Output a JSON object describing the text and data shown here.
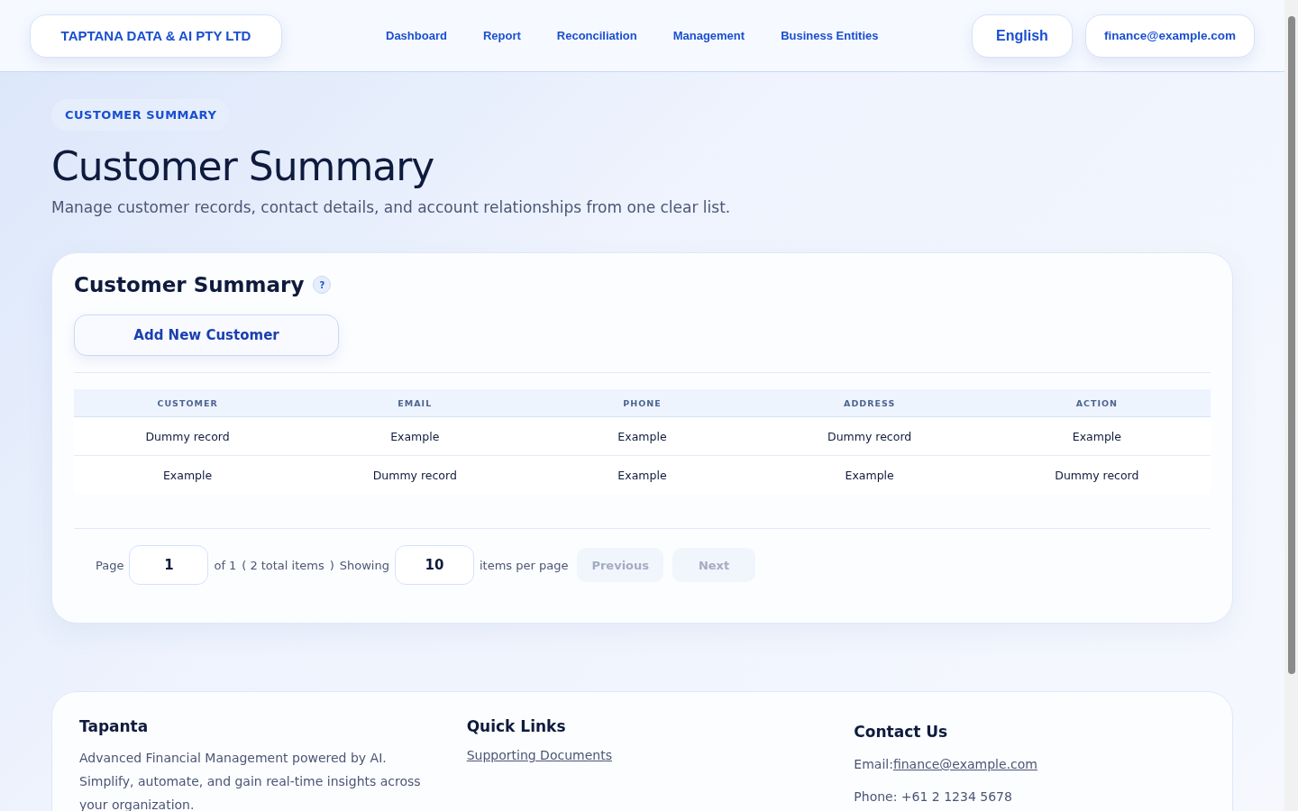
{
  "header": {
    "brand": "TAPTANA DATA & AI PTY LTD",
    "nav": [
      {
        "label": "Dashboard"
      },
      {
        "label": "Report"
      },
      {
        "label": "Reconciliation"
      },
      {
        "label": "Management"
      },
      {
        "label": "Business Entities"
      }
    ],
    "language": "English",
    "account": "finance@example.com"
  },
  "hero": {
    "eyebrow": "CUSTOMER SUMMARY",
    "title": "Customer Summary",
    "subtitle": "Manage customer records, contact details, and account relationships from one clear list."
  },
  "card": {
    "title": "Customer Summary",
    "help": "?",
    "add_button": "Add New Customer",
    "table": {
      "columns": [
        "CUSTOMER",
        "EMAIL",
        "PHONE",
        "ADDRESS",
        "ACTION"
      ],
      "rows": [
        [
          "Dummy record",
          "Example",
          "Example",
          "Dummy record",
          "Example"
        ],
        [
          "Example",
          "Dummy record",
          "Example",
          "Example",
          "Dummy record"
        ]
      ]
    },
    "pagination": {
      "page_label": "Page",
      "page": "1",
      "of_label": "of",
      "page_count": "1",
      "open_paren": "(",
      "total": "2",
      "total_label": "total items",
      "close_paren": ")",
      "showing_label": "Showing",
      "per_page": "10",
      "per_page_label": "items per page",
      "buttons": [
        {
          "label": "Previous",
          "disabled": true
        },
        {
          "label": "Next",
          "disabled": true
        }
      ]
    }
  },
  "footer": {
    "columns": [
      {
        "kind": "about",
        "title": "Tapanta",
        "text": "Advanced Financial Management powered by AI. Simplify, automate, and gain real-time insights across your organization."
      },
      {
        "kind": "links",
        "title": "Quick Links",
        "links": [
          "Supporting Documents"
        ]
      },
      {
        "kind": "contact",
        "title": "Contact Us",
        "email_label": "Email:",
        "email": "finance@example.com",
        "phone": "Phone: +61 2 1234 5678"
      }
    ]
  }
}
